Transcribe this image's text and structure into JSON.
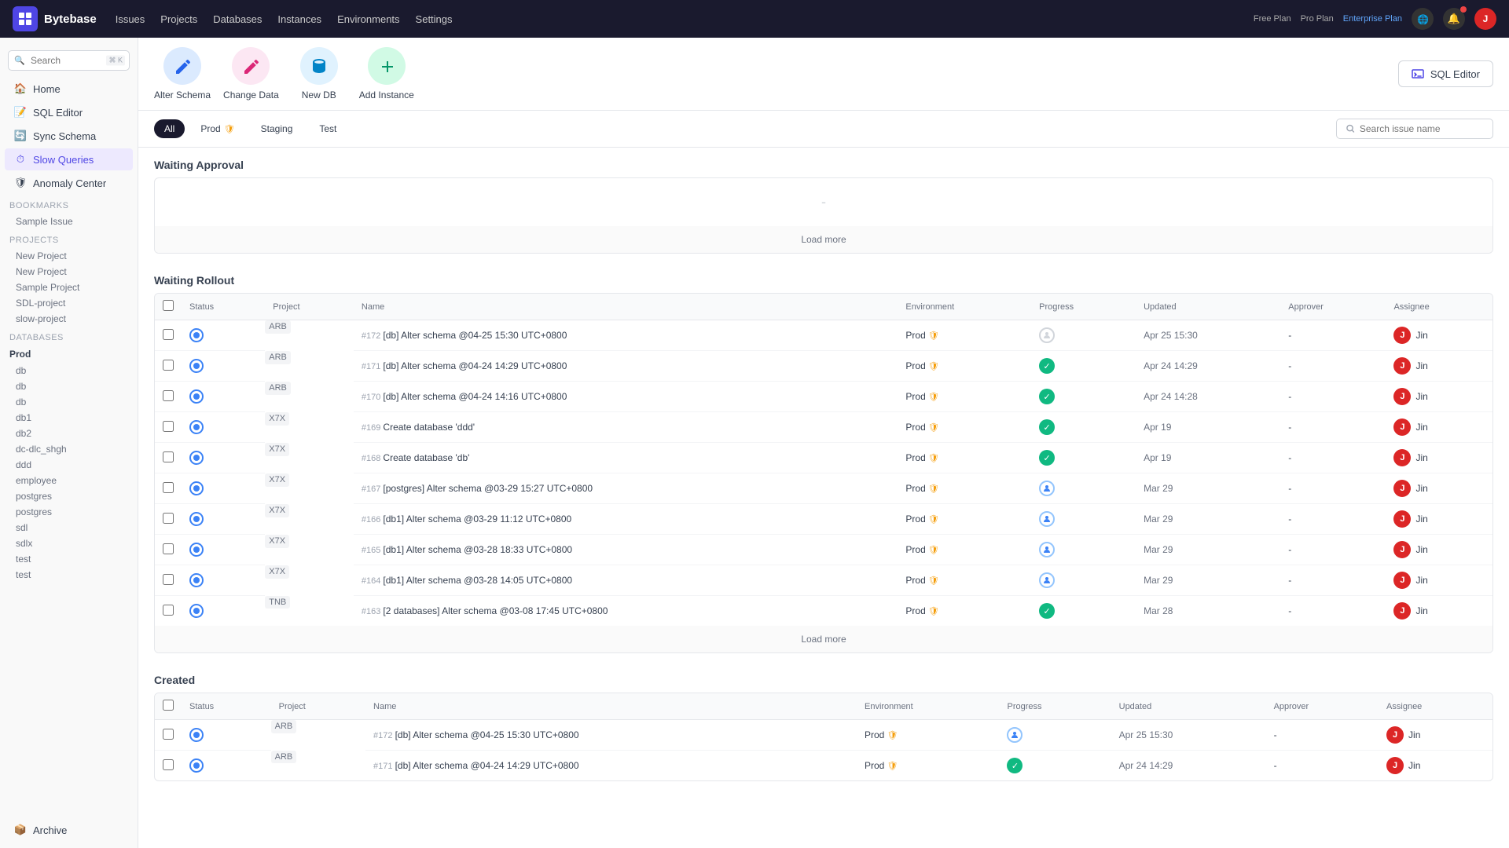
{
  "topnav": {
    "logo_text": "Bytebase",
    "links": [
      "Issues",
      "Projects",
      "Databases",
      "Instances",
      "Environments",
      "Settings"
    ],
    "plans": {
      "free": "Free Plan",
      "pro": "Pro Plan",
      "enterprise": "Enterprise Plan"
    },
    "avatar_text": "J"
  },
  "sidebar": {
    "search_placeholder": "Search",
    "search_kbd": "⌘ K",
    "nav_items": [
      {
        "id": "home",
        "label": "Home",
        "icon": "🏠"
      },
      {
        "id": "sql-editor",
        "label": "SQL Editor",
        "icon": "📝"
      },
      {
        "id": "sync-schema",
        "label": "Sync Schema",
        "icon": "🔄"
      },
      {
        "id": "slow-queries",
        "label": "Slow Queries",
        "icon": "⏱"
      },
      {
        "id": "anomaly-center",
        "label": "Anomaly Center",
        "icon": "🛡"
      }
    ],
    "bookmarks_section": "Bookmarks",
    "bookmarks": [
      "Sample Issue"
    ],
    "projects_section": "Projects",
    "projects": [
      "New Project",
      "New Project",
      "Sample Project",
      "SDL-project",
      "slow-project"
    ],
    "databases_section": "Databases",
    "db_parent": "Prod",
    "databases": [
      "db",
      "db",
      "db",
      "db1",
      "db2",
      "dc-dlc_shgh",
      "ddd",
      "employee",
      "postgres",
      "postgres",
      "sdl",
      "sdlx",
      "test",
      "test"
    ],
    "archive_label": "Archive"
  },
  "toolbar": {
    "buttons": [
      {
        "id": "alter-schema",
        "label": "Alter Schema",
        "icon": "✏️",
        "class": "icon-alter"
      },
      {
        "id": "change-data",
        "label": "Change Data",
        "icon": "📝",
        "class": "icon-change"
      },
      {
        "id": "new-db",
        "label": "New DB",
        "icon": "🗄",
        "class": "icon-newdb"
      },
      {
        "id": "add-instance",
        "label": "Add Instance",
        "icon": "➕",
        "class": "icon-add"
      }
    ],
    "sql_editor": "SQL Editor"
  },
  "filter": {
    "buttons": [
      "All",
      "Prod",
      "Staging",
      "Test"
    ],
    "active": "All",
    "search_placeholder": "Search issue name"
  },
  "sections": {
    "waiting_approval": {
      "title": "Waiting Approval",
      "empty_dash": "-",
      "load_more": "Load more"
    },
    "waiting_rollout": {
      "title": "Waiting Rollout",
      "load_more": "Load more",
      "columns": [
        "",
        "Status",
        "Project",
        "Name",
        "Environment",
        "Progress",
        "Updated",
        "Approver",
        "Assignee"
      ],
      "rows": [
        {
          "id": "#172",
          "project": "ARB",
          "name": "[db] Alter schema @04-25 15:30 UTC+0800",
          "env": "Prod",
          "env_shield": true,
          "progress": "pending",
          "updated": "Apr 25 15:30",
          "approver": "-",
          "assignee": "Jin"
        },
        {
          "id": "#171",
          "project": "ARB",
          "name": "[db] Alter schema @04-24 14:29 UTC+0800",
          "env": "Prod",
          "env_shield": true,
          "progress": "check",
          "updated": "Apr 24 14:29",
          "approver": "-",
          "assignee": "Jin"
        },
        {
          "id": "#170",
          "project": "ARB",
          "name": "[db] Alter schema @04-24 14:16 UTC+0800",
          "env": "Prod",
          "env_shield": true,
          "progress": "check",
          "updated": "Apr 24 14:28",
          "approver": "-",
          "assignee": "Jin"
        },
        {
          "id": "#169",
          "project": "X7X",
          "name": "Create database 'ddd'",
          "env": "Prod",
          "env_shield": true,
          "progress": "check",
          "updated": "Apr 19",
          "approver": "-",
          "assignee": "Jin"
        },
        {
          "id": "#168",
          "project": "X7X",
          "name": "Create database 'db'",
          "env": "Prod",
          "env_shield": true,
          "progress": "check",
          "updated": "Apr 19",
          "approver": "-",
          "assignee": "Jin"
        },
        {
          "id": "#167",
          "project": "X7X",
          "name": "[postgres] Alter schema @03-29 15:27 UTC+0800",
          "env": "Prod",
          "env_shield": true,
          "progress": "user",
          "updated": "Mar 29",
          "approver": "-",
          "assignee": "Jin"
        },
        {
          "id": "#166",
          "project": "X7X",
          "name": "[db1] Alter schema @03-29 11:12 UTC+0800",
          "env": "Prod",
          "env_shield": true,
          "progress": "user",
          "updated": "Mar 29",
          "approver": "-",
          "assignee": "Jin"
        },
        {
          "id": "#165",
          "project": "X7X",
          "name": "[db1] Alter schema @03-28 18:33 UTC+0800",
          "env": "Prod",
          "env_shield": true,
          "progress": "user",
          "updated": "Mar 29",
          "approver": "-",
          "assignee": "Jin"
        },
        {
          "id": "#164",
          "project": "X7X",
          "name": "[db1] Alter schema @03-28 14:05 UTC+0800",
          "env": "Prod",
          "env_shield": true,
          "progress": "user",
          "updated": "Mar 29",
          "approver": "-",
          "assignee": "Jin"
        },
        {
          "id": "#163",
          "project": "TNB",
          "name": "[2 databases] Alter schema @03-08 17:45 UTC+0800",
          "env": "Prod",
          "env_shield": true,
          "progress": "check",
          "updated": "Mar 28",
          "approver": "-",
          "assignee": "Jin"
        }
      ]
    },
    "created": {
      "title": "Created",
      "columns": [
        "",
        "Status",
        "Project",
        "Name",
        "Environment",
        "Progress",
        "Updated",
        "Approver",
        "Assignee"
      ],
      "rows": [
        {
          "id": "#172",
          "project": "ARB",
          "name": "[db] Alter schema @04-25 15:30 UTC+0800",
          "env": "Prod",
          "env_shield": true,
          "progress": "user",
          "updated": "Apr 25 15:30",
          "approver": "-",
          "assignee": "Jin"
        },
        {
          "id": "#171",
          "project": "ARB",
          "name": "[db] Alter schema @04-24 14:29 UTC+0800",
          "env": "Prod",
          "env_shield": true,
          "progress": "check",
          "updated": "Apr 24 14:29",
          "approver": "-",
          "assignee": "Jin"
        }
      ]
    }
  }
}
